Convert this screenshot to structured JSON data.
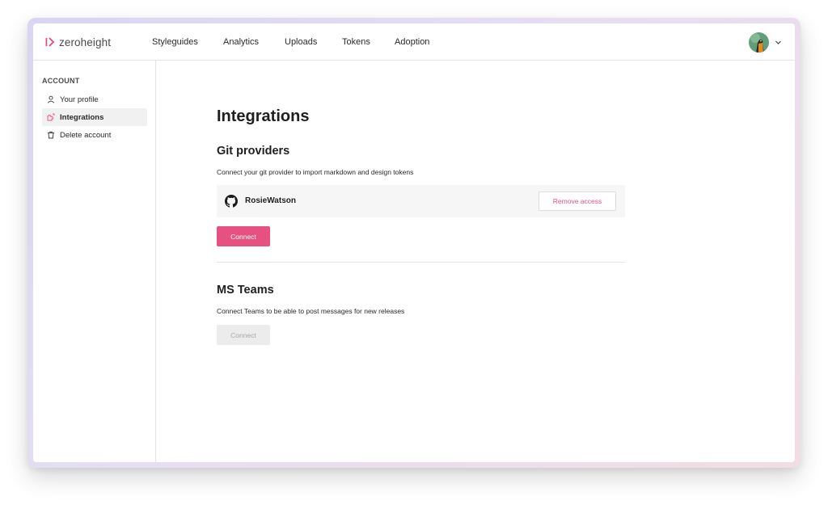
{
  "brand": {
    "name": "zeroheight",
    "accent_color": "#e65182"
  },
  "nav": {
    "items": [
      {
        "label": "Styleguides"
      },
      {
        "label": "Analytics"
      },
      {
        "label": "Uploads"
      },
      {
        "label": "Tokens"
      },
      {
        "label": "Adoption"
      }
    ],
    "avatar_icon": "user-avatar",
    "menu_icon": "chevron-down-icon"
  },
  "sidebar": {
    "heading": "ACCOUNT",
    "items": [
      {
        "label": "Your profile",
        "icon": "user-icon",
        "active": false
      },
      {
        "label": "Integrations",
        "icon": "puzzle-icon",
        "active": true
      },
      {
        "label": "Delete account",
        "icon": "trash-icon",
        "active": false
      }
    ]
  },
  "main": {
    "title": "Integrations",
    "git": {
      "title": "Git providers",
      "description": "Connect your git provider to import markdown and design tokens",
      "provider": {
        "icon": "github-icon",
        "username": "RosieWatson",
        "remove_label": "Remove access"
      },
      "connect_label": "Connect"
    },
    "teams": {
      "title": "MS Teams",
      "description": "Connect Teams to be able to post messages for new releases",
      "connect_label": "Connect",
      "connect_disabled": true
    }
  }
}
